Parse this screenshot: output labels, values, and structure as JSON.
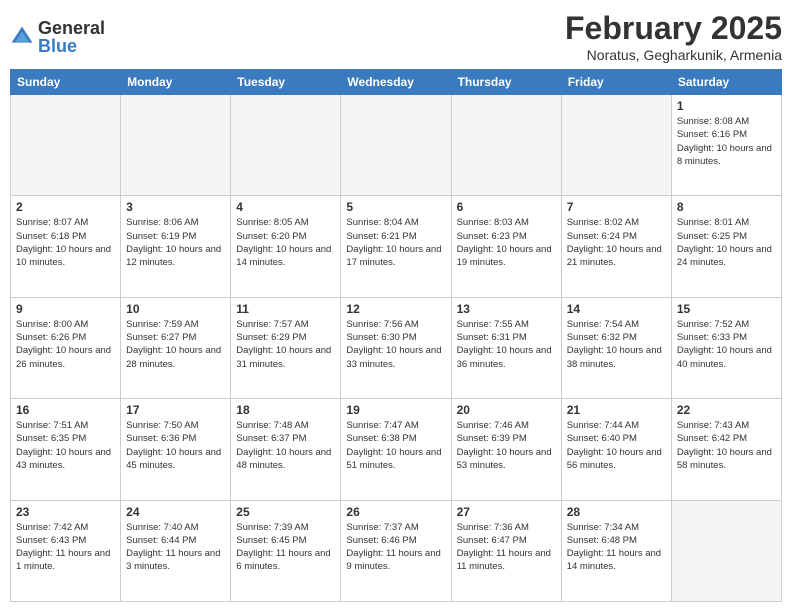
{
  "logo": {
    "general": "General",
    "blue": "Blue"
  },
  "header": {
    "title": "February 2025",
    "location": "Noratus, Gegharkunik, Armenia"
  },
  "days_of_week": [
    "Sunday",
    "Monday",
    "Tuesday",
    "Wednesday",
    "Thursday",
    "Friday",
    "Saturday"
  ],
  "weeks": [
    [
      {
        "day": "",
        "info": ""
      },
      {
        "day": "",
        "info": ""
      },
      {
        "day": "",
        "info": ""
      },
      {
        "day": "",
        "info": ""
      },
      {
        "day": "",
        "info": ""
      },
      {
        "day": "",
        "info": ""
      },
      {
        "day": "1",
        "info": "Sunrise: 8:08 AM\nSunset: 6:16 PM\nDaylight: 10 hours and 8 minutes."
      }
    ],
    [
      {
        "day": "2",
        "info": "Sunrise: 8:07 AM\nSunset: 6:18 PM\nDaylight: 10 hours and 10 minutes."
      },
      {
        "day": "3",
        "info": "Sunrise: 8:06 AM\nSunset: 6:19 PM\nDaylight: 10 hours and 12 minutes."
      },
      {
        "day": "4",
        "info": "Sunrise: 8:05 AM\nSunset: 6:20 PM\nDaylight: 10 hours and 14 minutes."
      },
      {
        "day": "5",
        "info": "Sunrise: 8:04 AM\nSunset: 6:21 PM\nDaylight: 10 hours and 17 minutes."
      },
      {
        "day": "6",
        "info": "Sunrise: 8:03 AM\nSunset: 6:23 PM\nDaylight: 10 hours and 19 minutes."
      },
      {
        "day": "7",
        "info": "Sunrise: 8:02 AM\nSunset: 6:24 PM\nDaylight: 10 hours and 21 minutes."
      },
      {
        "day": "8",
        "info": "Sunrise: 8:01 AM\nSunset: 6:25 PM\nDaylight: 10 hours and 24 minutes."
      }
    ],
    [
      {
        "day": "9",
        "info": "Sunrise: 8:00 AM\nSunset: 6:26 PM\nDaylight: 10 hours and 26 minutes."
      },
      {
        "day": "10",
        "info": "Sunrise: 7:59 AM\nSunset: 6:27 PM\nDaylight: 10 hours and 28 minutes."
      },
      {
        "day": "11",
        "info": "Sunrise: 7:57 AM\nSunset: 6:29 PM\nDaylight: 10 hours and 31 minutes."
      },
      {
        "day": "12",
        "info": "Sunrise: 7:56 AM\nSunset: 6:30 PM\nDaylight: 10 hours and 33 minutes."
      },
      {
        "day": "13",
        "info": "Sunrise: 7:55 AM\nSunset: 6:31 PM\nDaylight: 10 hours and 36 minutes."
      },
      {
        "day": "14",
        "info": "Sunrise: 7:54 AM\nSunset: 6:32 PM\nDaylight: 10 hours and 38 minutes."
      },
      {
        "day": "15",
        "info": "Sunrise: 7:52 AM\nSunset: 6:33 PM\nDaylight: 10 hours and 40 minutes."
      }
    ],
    [
      {
        "day": "16",
        "info": "Sunrise: 7:51 AM\nSunset: 6:35 PM\nDaylight: 10 hours and 43 minutes."
      },
      {
        "day": "17",
        "info": "Sunrise: 7:50 AM\nSunset: 6:36 PM\nDaylight: 10 hours and 45 minutes."
      },
      {
        "day": "18",
        "info": "Sunrise: 7:48 AM\nSunset: 6:37 PM\nDaylight: 10 hours and 48 minutes."
      },
      {
        "day": "19",
        "info": "Sunrise: 7:47 AM\nSunset: 6:38 PM\nDaylight: 10 hours and 51 minutes."
      },
      {
        "day": "20",
        "info": "Sunrise: 7:46 AM\nSunset: 6:39 PM\nDaylight: 10 hours and 53 minutes."
      },
      {
        "day": "21",
        "info": "Sunrise: 7:44 AM\nSunset: 6:40 PM\nDaylight: 10 hours and 56 minutes."
      },
      {
        "day": "22",
        "info": "Sunrise: 7:43 AM\nSunset: 6:42 PM\nDaylight: 10 hours and 58 minutes."
      }
    ],
    [
      {
        "day": "23",
        "info": "Sunrise: 7:42 AM\nSunset: 6:43 PM\nDaylight: 11 hours and 1 minute."
      },
      {
        "day": "24",
        "info": "Sunrise: 7:40 AM\nSunset: 6:44 PM\nDaylight: 11 hours and 3 minutes."
      },
      {
        "day": "25",
        "info": "Sunrise: 7:39 AM\nSunset: 6:45 PM\nDaylight: 11 hours and 6 minutes."
      },
      {
        "day": "26",
        "info": "Sunrise: 7:37 AM\nSunset: 6:46 PM\nDaylight: 11 hours and 9 minutes."
      },
      {
        "day": "27",
        "info": "Sunrise: 7:36 AM\nSunset: 6:47 PM\nDaylight: 11 hours and 11 minutes."
      },
      {
        "day": "28",
        "info": "Sunrise: 7:34 AM\nSunset: 6:48 PM\nDaylight: 11 hours and 14 minutes."
      },
      {
        "day": "",
        "info": ""
      }
    ]
  ]
}
